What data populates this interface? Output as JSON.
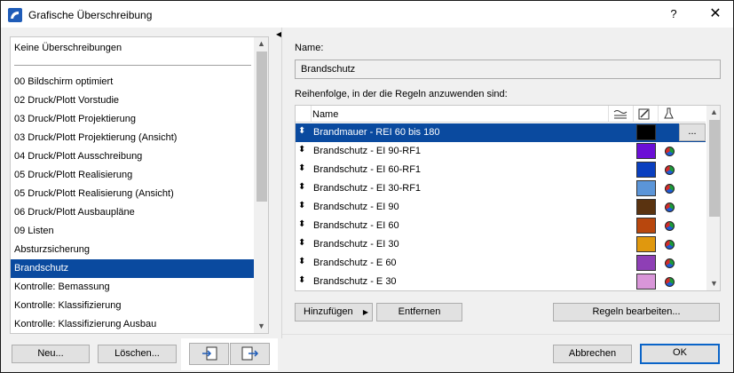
{
  "window": {
    "title": "Grafische Überschreibung",
    "help": "?",
    "close": "✕"
  },
  "left": {
    "none_item": "Keine Überschreibungen",
    "items": [
      "00 Bildschirm optimiert",
      "02 Druck/Plott Vorstudie",
      "03 Druck/Plott Projektierung",
      "03 Druck/Plott Projektierung (Ansicht)",
      "04 Druck/Plott Ausschreibung",
      "05 Druck/Plott Realisierung",
      "05 Druck/Plott Realisierung (Ansicht)",
      "06 Druck/Plott Ausbaupläne",
      "09 Listen",
      "Absturzsicherung",
      "Brandschutz",
      "Kontrolle: Bemassung",
      "Kontrolle: Klassifizierung",
      "Kontrolle: Klassifizierung Ausbau"
    ],
    "selected_index": 10,
    "buttons": {
      "new": "Neu...",
      "delete": "Löschen..."
    }
  },
  "right": {
    "name_label": "Name:",
    "name_value": "Brandschutz",
    "rules_label": "Reihenfolge, in der die Regeln anzuwenden sind:",
    "column_name": "Name",
    "header_icons": [
      "surface-fill-icon",
      "pen-icon",
      "material-icon"
    ],
    "more_label": "...",
    "rules": [
      {
        "name": "Brandmauer - REI 60 bis 180",
        "color": "#000000",
        "selected": true
      },
      {
        "name": "Brandschutz - EI 90-RF1",
        "color": "#6b0fd6"
      },
      {
        "name": "Brandschutz - EI 60-RF1",
        "color": "#0a3fbf"
      },
      {
        "name": "Brandschutz - EI 30-RF1",
        "color": "#5b95d8"
      },
      {
        "name": "Brandschutz - EI 90",
        "color": "#5a3310"
      },
      {
        "name": "Brandschutz - EI 60",
        "color": "#b8470d"
      },
      {
        "name": "Brandschutz - EI 30",
        "color": "#e0980e"
      },
      {
        "name": "Brandschutz - E 60",
        "color": "#8e3fb5"
      },
      {
        "name": "Brandschutz - E 30",
        "color": "#d996d9"
      }
    ],
    "buttons": {
      "add": "Hinzufügen",
      "remove": "Entfernen",
      "edit_rules": "Regeln bearbeiten...",
      "cancel": "Abbrechen",
      "ok": "OK"
    }
  }
}
